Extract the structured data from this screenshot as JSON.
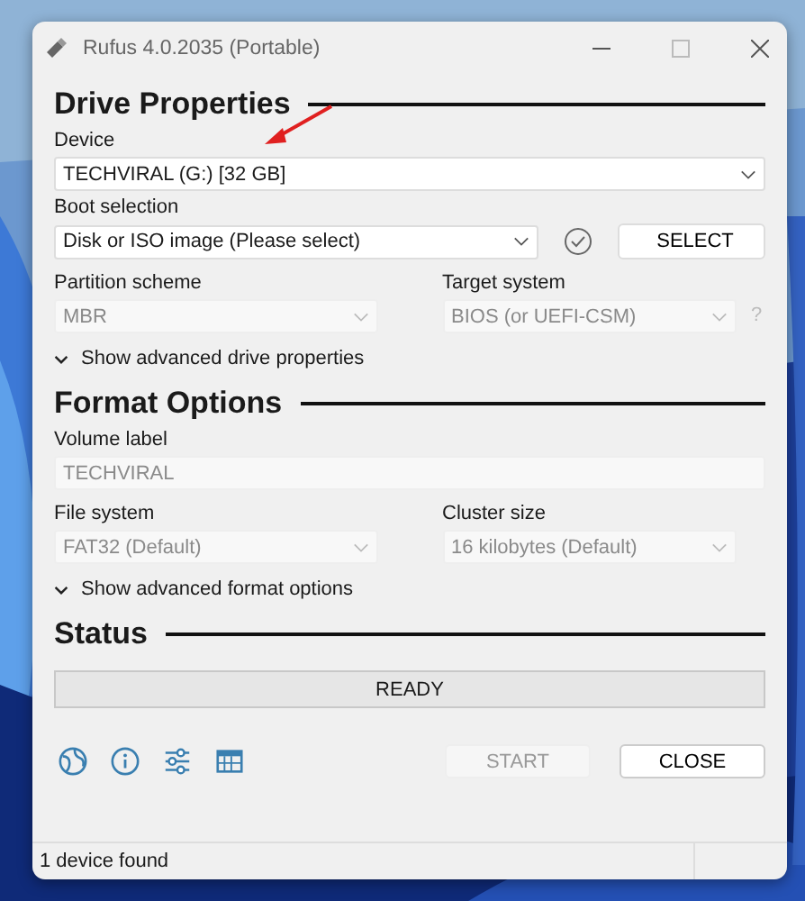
{
  "window": {
    "title": "Rufus 4.0.2035 (Portable)"
  },
  "drive_properties": {
    "heading": "Drive Properties",
    "device": {
      "label": "Device",
      "value": "TECHVIRAL (G:) [32 GB]",
      "disabled": false
    },
    "boot_selection": {
      "label": "Boot selection",
      "value": "Disk or ISO image (Please select)",
      "disabled": false,
      "button": "SELECT"
    },
    "partition_scheme": {
      "label": "Partition scheme",
      "value": "MBR",
      "disabled": true
    },
    "target_system": {
      "label": "Target system",
      "value": "BIOS (or UEFI-CSM)",
      "disabled": true,
      "help": "?"
    },
    "advanced_toggle": {
      "label": "Show advanced drive properties",
      "expanded": false
    }
  },
  "format_options": {
    "heading": "Format Options",
    "volume_label": {
      "label": "Volume label",
      "value": "TECHVIRAL",
      "disabled": true
    },
    "file_system": {
      "label": "File system",
      "value": "FAT32 (Default)",
      "disabled": true
    },
    "cluster_size": {
      "label": "Cluster size",
      "value": "16 kilobytes (Default)",
      "disabled": true
    },
    "advanced_toggle": {
      "label": "Show advanced format options",
      "expanded": false
    }
  },
  "status": {
    "heading": "Status",
    "progress": {
      "text": "READY"
    }
  },
  "buttons": [
    {
      "label": "START",
      "disabled": true
    },
    {
      "label": "CLOSE",
      "disabled": false
    }
  ],
  "status_bar": "1 device found"
}
